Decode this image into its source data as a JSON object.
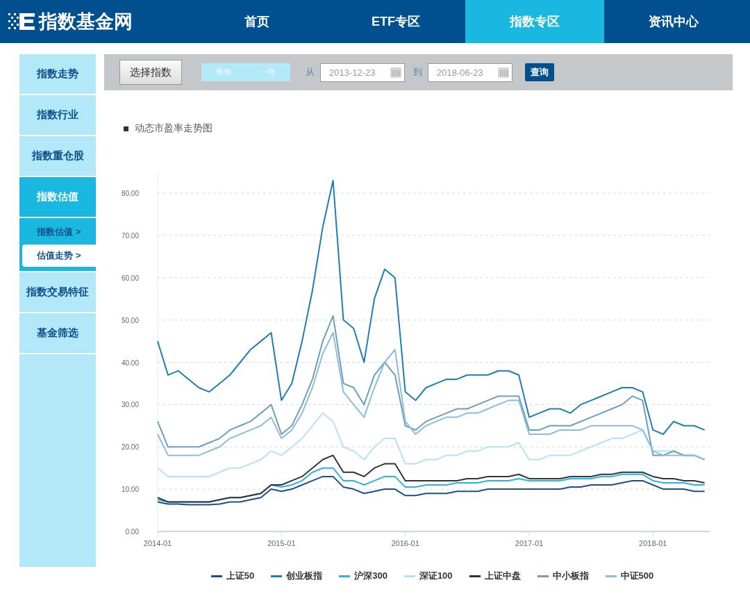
{
  "header": {
    "logo": "指数基金网",
    "nav": [
      {
        "label": "首页",
        "selected": false
      },
      {
        "label": "ETF专区",
        "selected": false
      },
      {
        "label": "指数专区",
        "selected": true
      },
      {
        "label": "资讯中心",
        "selected": false
      }
    ]
  },
  "sidebar": {
    "items": [
      {
        "label": "指数走势",
        "selected": false
      },
      {
        "label": "指数行业",
        "selected": false
      },
      {
        "label": "指数重仓股",
        "selected": false
      },
      {
        "label": "指数估值",
        "selected": true,
        "children": [
          {
            "label": "指数估值 >",
            "selected": false
          },
          {
            "label": "估值走势 >",
            "selected": true
          }
        ]
      },
      {
        "label": "指数交易特征",
        "selected": false
      },
      {
        "label": "基金筛选",
        "selected": false
      }
    ]
  },
  "toolbar": {
    "select_button": "选择指数",
    "periods": [
      {
        "label": "半年",
        "selected": false
      },
      {
        "label": "一年",
        "selected": false
      }
    ],
    "from_label": "从",
    "from_date": "2013-12-23",
    "to_label": "到",
    "to_date": "2018-06-23",
    "query_button": "查询"
  },
  "chart": {
    "title": "动态市盈率走势图",
    "chart_data": {
      "type": "line",
      "categories": [
        "2014-01",
        null,
        null,
        null,
        null,
        null,
        null,
        null,
        null,
        null,
        null,
        null,
        "2015-01",
        null,
        null,
        null,
        null,
        null,
        null,
        null,
        null,
        null,
        null,
        null,
        "2016-01",
        null,
        null,
        null,
        null,
        null,
        null,
        null,
        null,
        null,
        null,
        null,
        "2017-01",
        null,
        null,
        null,
        null,
        null,
        null,
        null,
        null,
        null,
        null,
        null,
        "2018-01",
        null,
        null,
        null,
        null,
        null
      ],
      "grid": true,
      "ylim": [
        0,
        85
      ],
      "yticks": [
        {
          "value": 0,
          "label": "0.00"
        },
        {
          "value": 10,
          "label": "10.00"
        },
        {
          "value": 20,
          "label": "20.00"
        },
        {
          "value": 30,
          "label": "30.00"
        },
        {
          "value": 40,
          "label": "40.00"
        },
        {
          "value": 50,
          "label": "50.00"
        },
        {
          "value": 60,
          "label": "60.00"
        },
        {
          "value": 70,
          "label": "70.00"
        },
        {
          "value": 80,
          "label": "80.00"
        }
      ],
      "series": [
        {
          "name": "上证50",
          "color": "#1a4f8a",
          "values": [
            7,
            6.5,
            6.5,
            6.3,
            6.3,
            6.3,
            6.5,
            7,
            7,
            7.5,
            8,
            10,
            9.5,
            10,
            11,
            12,
            13,
            13,
            10.5,
            10,
            9,
            9.5,
            10,
            10,
            8.5,
            8.5,
            9,
            9,
            9,
            9.5,
            9.5,
            9.5,
            10,
            10,
            10,
            10,
            10,
            10,
            10,
            10,
            10.5,
            10.5,
            11,
            11,
            11,
            11.5,
            12,
            12,
            11,
            10,
            10,
            10,
            9.5,
            9.5
          ]
        },
        {
          "name": "创业板指",
          "color": "#1a7fb5",
          "values": [
            45,
            37,
            38,
            36,
            34,
            33,
            35,
            37,
            40,
            43,
            45,
            47,
            31,
            35,
            45,
            57,
            72,
            83,
            50,
            48,
            40,
            55,
            62,
            60,
            33,
            31,
            34,
            35,
            36,
            36,
            37,
            37,
            37,
            38,
            38,
            37,
            27,
            28,
            29,
            29,
            28,
            30,
            31,
            32,
            33,
            34,
            34,
            33,
            24,
            23,
            26,
            25,
            25,
            24
          ]
        },
        {
          "name": "沪深300",
          "color": "#29b6d8",
          "values": [
            7.5,
            7,
            7,
            7,
            7,
            7,
            7.5,
            8,
            8,
            8.5,
            9,
            11,
            10.5,
            11,
            12,
            14,
            15,
            15,
            12,
            12,
            11,
            12,
            13,
            13,
            10.5,
            10.5,
            11,
            11,
            11,
            11.5,
            11.5,
            11.5,
            12,
            12,
            12,
            12.5,
            12,
            12,
            12,
            12,
            12.5,
            12.5,
            12.5,
            13,
            13,
            13.5,
            13.5,
            13.5,
            12,
            11.5,
            11.5,
            11.5,
            11,
            11
          ]
        },
        {
          "name": "深证100",
          "color": "#b3e3f4",
          "values": [
            15,
            13,
            13,
            13,
            13,
            13,
            14,
            15,
            15,
            16,
            17,
            19,
            18,
            20,
            22,
            25,
            28,
            26,
            20,
            19,
            17,
            20,
            22,
            22,
            16,
            16,
            17,
            17,
            18,
            18,
            19,
            19,
            20,
            20,
            20,
            21,
            17,
            17,
            18,
            18,
            18,
            19,
            20,
            21,
            22,
            22,
            23,
            24,
            19,
            19,
            19,
            18,
            18,
            17
          ]
        },
        {
          "name": "上证中盘",
          "color": "#333333",
          "values": [
            8,
            7,
            7,
            7,
            7,
            7,
            7.5,
            8,
            8,
            8.5,
            9,
            11,
            11,
            12,
            13,
            15,
            17,
            18,
            14,
            14,
            13,
            15,
            16,
            16,
            12,
            12,
            12,
            12,
            12,
            12,
            12.5,
            12.5,
            13,
            13,
            13,
            13.5,
            12.5,
            12.5,
            12.5,
            12.5,
            13,
            13,
            13,
            13.5,
            13.5,
            14,
            14,
            14,
            13,
            12.5,
            12.5,
            12,
            12,
            11.5
          ]
        },
        {
          "name": "中小板指",
          "color": "#6a9fc0",
          "values": [
            26,
            20,
            20,
            20,
            20,
            21,
            22,
            24,
            25,
            26,
            28,
            30,
            23,
            25,
            30,
            36,
            45,
            51,
            35,
            34,
            30,
            37,
            40,
            37,
            25,
            24,
            26,
            27,
            28,
            29,
            29,
            30,
            31,
            32,
            32,
            32,
            24,
            24,
            25,
            25,
            25,
            26,
            27,
            28,
            29,
            30,
            32,
            31,
            18,
            18,
            19,
            18,
            18,
            17
          ]
        },
        {
          "name": "中证500",
          "color": "#8bbcd8",
          "values": [
            23,
            18,
            18,
            18,
            18,
            19,
            20,
            22,
            23,
            24,
            25,
            27,
            22,
            24,
            28,
            34,
            42,
            47,
            33,
            30,
            27,
            34,
            40,
            43,
            26,
            23,
            25,
            26,
            27,
            27,
            28,
            28,
            29,
            30,
            31,
            31,
            23,
            23,
            23,
            24,
            24,
            24,
            25,
            25,
            25,
            25,
            25,
            24,
            19,
            18,
            18,
            18,
            18,
            17
          ]
        }
      ]
    }
  }
}
